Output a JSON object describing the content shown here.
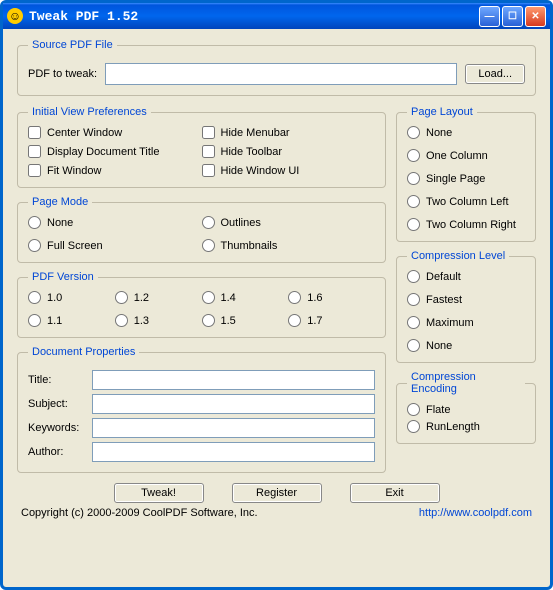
{
  "window": {
    "title": "Tweak PDF 1.52"
  },
  "source": {
    "legend": "Source PDF File",
    "label": "PDF to tweak:",
    "path": "",
    "load_btn": "Load..."
  },
  "ivp": {
    "legend": "Initial View Preferences",
    "items": [
      "Center Window",
      "Display Document Title",
      "Fit Window",
      "Hide Menubar",
      "Hide Toolbar",
      "Hide Window UI"
    ]
  },
  "page_mode": {
    "legend": "Page Mode",
    "items": [
      "None",
      "Full Screen",
      "Outlines",
      "Thumbnails"
    ]
  },
  "pdf_version": {
    "legend": "PDF Version",
    "items": [
      "1.0",
      "1.1",
      "1.2",
      "1.3",
      "1.4",
      "1.5",
      "1.6",
      "1.7"
    ]
  },
  "doc_props": {
    "legend": "Document Properties",
    "title_label": "Title:",
    "subject_label": "Subject:",
    "keywords_label": "Keywords:",
    "author_label": "Author:",
    "title": "",
    "subject": "",
    "keywords": "",
    "author": ""
  },
  "page_layout": {
    "legend": "Page Layout",
    "items": [
      "None",
      "One Column",
      "Single Page",
      "Two Column Left",
      "Two Column Right"
    ]
  },
  "compression_level": {
    "legend": "Compression Level",
    "items": [
      "Default",
      "Fastest",
      "Maximum",
      "None"
    ]
  },
  "compression_encoding": {
    "legend": "Compression Encoding",
    "items": [
      "Flate",
      "RunLength"
    ]
  },
  "buttons": {
    "tweak": "Tweak!",
    "register": "Register",
    "exit": "Exit"
  },
  "footer": {
    "copyright": "Copyright (c) 2000-2009 CoolPDF Software, Inc.",
    "url": "http://www.coolpdf.com"
  }
}
